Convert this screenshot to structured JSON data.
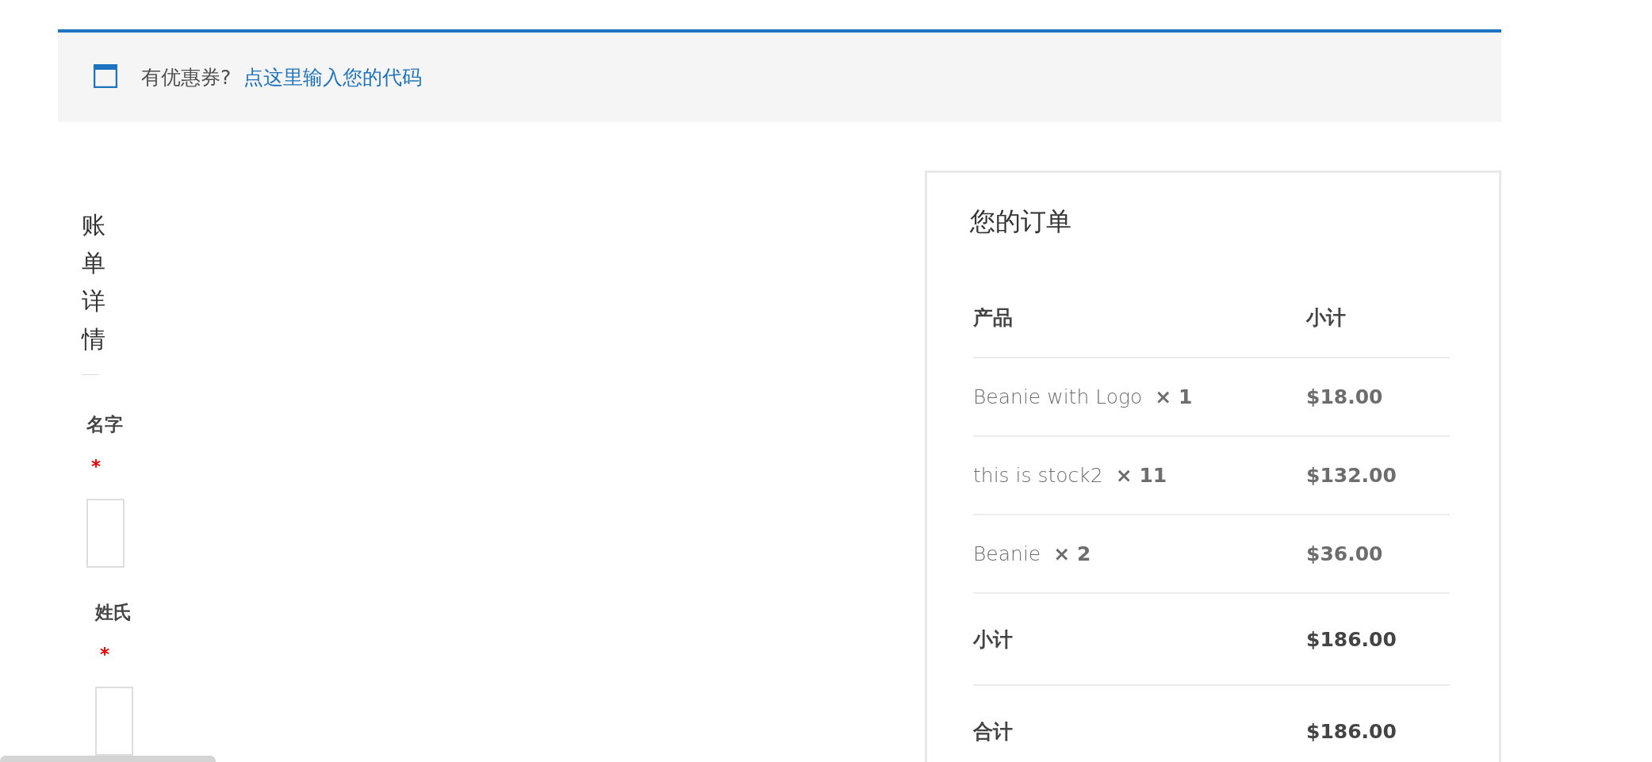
{
  "notice": {
    "text": "有优惠券?",
    "link": "点这里输入您的代码"
  },
  "billing": {
    "title": "账单详情",
    "fields": [
      {
        "label": "名字",
        "required_mark": "*"
      },
      {
        "label": "姓氏",
        "required_mark": "*"
      }
    ]
  },
  "order": {
    "title": "您的订单",
    "columns": [
      "产品",
      "小计"
    ],
    "items": [
      {
        "name": "Beanie with Logo",
        "qty": "× 1",
        "subtotal": "$18.00"
      },
      {
        "name": "this is stock2",
        "qty": "× 11",
        "subtotal": "$132.00"
      },
      {
        "name": "Beanie",
        "qty": "× 2",
        "subtotal": "$36.00"
      }
    ],
    "totals": [
      {
        "label": "小计",
        "value": "$186.00"
      },
      {
        "label": "合计",
        "value": "$186.00"
      }
    ]
  }
}
